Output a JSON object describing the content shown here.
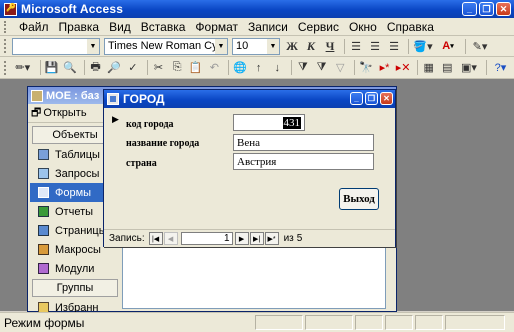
{
  "app": {
    "title": "Microsoft Access"
  },
  "menu": [
    "Файл",
    "Правка",
    "Вид",
    "Вставка",
    "Формат",
    "Записи",
    "Сервис",
    "Окно",
    "Справка"
  ],
  "format_toolbar": {
    "object_combo": "",
    "font_name": "Times New Roman Cyr",
    "font_size": "10",
    "bold": "Ж",
    "italic": "К",
    "underline": "Ч"
  },
  "db_window": {
    "title": "МОЕ : баз",
    "open_label": "Открыть",
    "objects_header": "Объекты",
    "objects": [
      "Таблицы",
      "Запросы",
      "Формы",
      "Отчеты",
      "Страницы",
      "Макросы",
      "Модули"
    ],
    "selected_object": "Формы",
    "groups_header": "Группы",
    "groups": [
      "Избранн"
    ]
  },
  "form_window": {
    "title": "ГОРОД",
    "fields": [
      {
        "label": "код города",
        "value": "431"
      },
      {
        "label": "название города",
        "value": "Вена"
      },
      {
        "label": "страна",
        "value": "Австрия"
      }
    ],
    "exit_button": "Выход",
    "nav": {
      "label": "Запись:",
      "current": "1",
      "of": "из",
      "total": "5"
    }
  },
  "status": {
    "text": "Режим формы"
  },
  "colors": {
    "title_bar": "#0a46c4",
    "selection": "#316ac5",
    "workspace": "#808080"
  }
}
